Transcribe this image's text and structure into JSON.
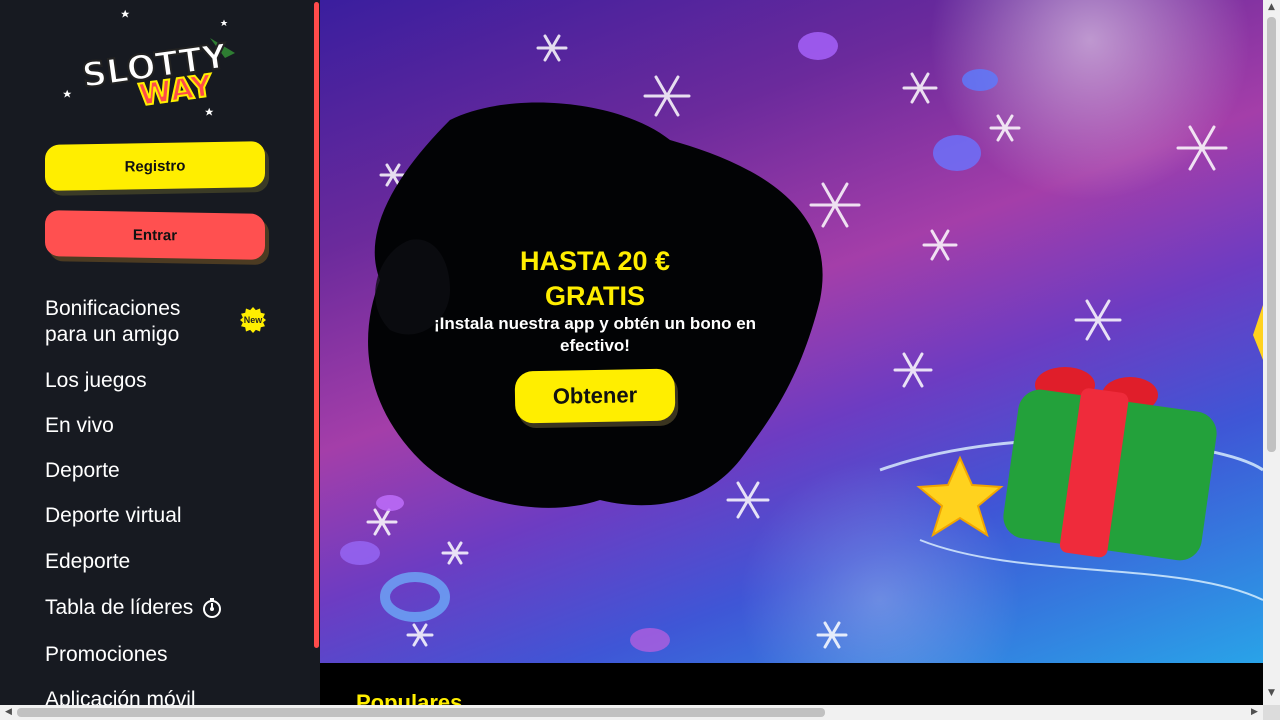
{
  "brand": {
    "line1": "SLOTTY",
    "line2": "WAY"
  },
  "buttons": {
    "register": "Registro",
    "login": "Entrar"
  },
  "menu": [
    {
      "label": "Bonificaciones para un amigo",
      "badge": "New"
    },
    {
      "label": "Los juegos"
    },
    {
      "label": "En vivo"
    },
    {
      "label": "Deporte"
    },
    {
      "label": "Deporte virtual"
    },
    {
      "label": "Edeporte"
    },
    {
      "label": "Tabla de líderes",
      "icon": "stopwatch-icon"
    },
    {
      "label": "Promociones"
    },
    {
      "label": "Aplicación móvil"
    }
  ],
  "promo": {
    "title": "HASTA 20 € GRATIS",
    "subtitle": "¡Instala nuestra app y obtén un bono en efectivo!",
    "cta": "Obtener"
  },
  "section": {
    "title": "Populares"
  },
  "colors": {
    "accent_yellow": "#ffee00",
    "accent_red": "#ff5050",
    "sidebar_bg": "#171a21"
  },
  "scrollbars": {
    "up": "▲",
    "down": "▼",
    "left": "◀",
    "right": "▶"
  }
}
